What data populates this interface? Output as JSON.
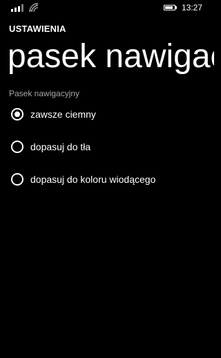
{
  "status_bar": {
    "time": "13:27",
    "signal_icon": "signal-strength-icon",
    "wifi_icon": "wifi-icon",
    "battery_icon": "battery-icon",
    "battery_level": 0.85
  },
  "header": {
    "app_title": "USTAWIENIA",
    "page_title": "pasek nawigacyjny"
  },
  "section": {
    "label": "Pasek nawigacyjny",
    "options": [
      {
        "label": "zawsze ciemny",
        "selected": true
      },
      {
        "label": "dopasuj do tła",
        "selected": false
      },
      {
        "label": "dopasuj do koloru wiodącego",
        "selected": false
      }
    ]
  },
  "colors": {
    "background": "#000000",
    "foreground": "#ffffff",
    "subtle": "#a8a8a8"
  }
}
